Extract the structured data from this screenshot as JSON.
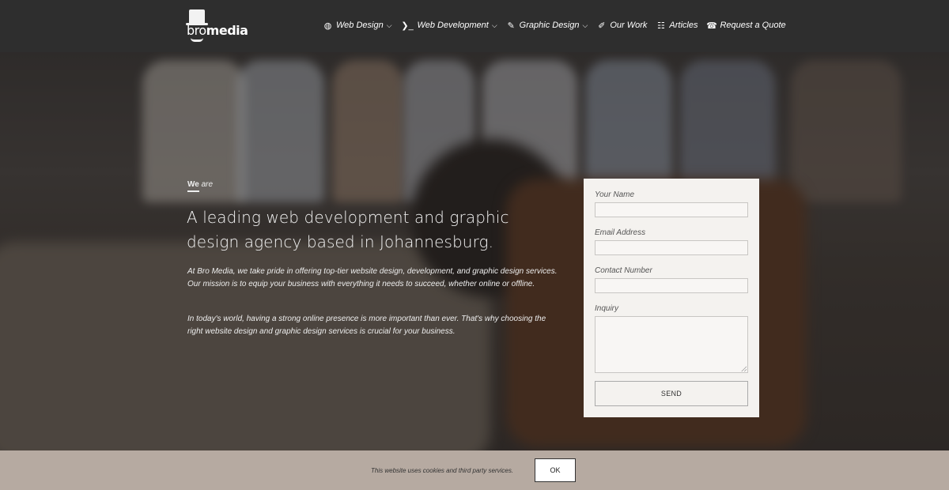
{
  "header": {
    "logo": {
      "text_thin": "bro",
      "text_bold": "media"
    },
    "nav": [
      {
        "label": "Web Design",
        "icon": "globe-icon",
        "glyph": "◍",
        "dropdown": true
      },
      {
        "label": "Web Development",
        "icon": "terminal-icon",
        "glyph": "❯_",
        "dropdown": true
      },
      {
        "label": "Graphic Design",
        "icon": "pencil-icon",
        "glyph": "✎",
        "dropdown": true
      },
      {
        "label": "Our Work",
        "icon": "brush-icon",
        "glyph": "✐",
        "dropdown": false
      },
      {
        "label": "Articles",
        "icon": "newspaper-icon",
        "glyph": "☷",
        "dropdown": false
      },
      {
        "label": "Request a Quote",
        "icon": "phone-icon",
        "glyph": "☎",
        "dropdown": false
      }
    ]
  },
  "hero": {
    "we": "We",
    "are": " are",
    "headline": "A leading web development and graphic design agency based in Johannesburg.",
    "paragraphs": [
      "At Bro Media, we take pride in offering top-tier website design, development, and graphic design services. Our mission is to equip your business with everything it needs to succeed, whether online or offline.",
      "In today's world, having a strong online presence is more important than ever. That's why choosing the right website design and graphic design services is crucial for your business."
    ]
  },
  "form": {
    "name_label": "Your Name",
    "email_label": "Email Address",
    "phone_label": "Contact Number",
    "inquiry_label": "Inquiry",
    "send_label": "SEND"
  },
  "cookie": {
    "message": "This website uses cookies and third party services.",
    "ok_label": "OK"
  },
  "colors": {
    "header_bg": "#2e2e2e",
    "form_bg": "#f4f2ef",
    "cookie_bg": "#b6aaa1"
  }
}
